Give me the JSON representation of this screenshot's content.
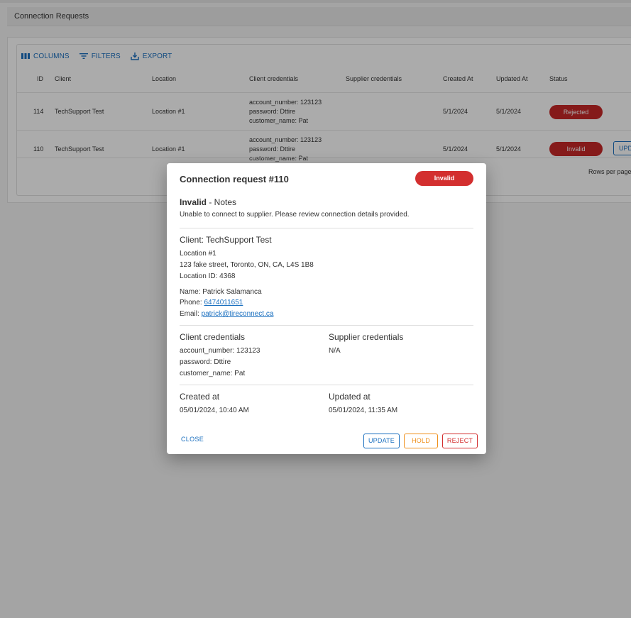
{
  "page": {
    "title": "Connection Requests"
  },
  "toolbar": {
    "columns": "COLUMNS",
    "filters": "FILTERS",
    "export": "EXPORT"
  },
  "table": {
    "headers": [
      "ID",
      "Client",
      "Location",
      "Client credentials",
      "Supplier credentials",
      "Created At",
      "Updated At",
      "Status"
    ],
    "rows": [
      {
        "id": "114",
        "client": "TechSupport Test",
        "location": "Location #1",
        "cred": [
          "account_number: 123123",
          "password: Dttire",
          "customer_name: Pat"
        ],
        "created": "5/1/2024",
        "updated": "5/1/2024",
        "status": "Rejected"
      },
      {
        "id": "110",
        "client": "TechSupport Test",
        "location": "Location #1",
        "cred": [
          "account_number: 123123",
          "password: Dttire",
          "customer_name: Pat"
        ],
        "created": "5/1/2024",
        "updated": "5/1/2024",
        "status": "Invalid",
        "action": "UPD"
      }
    ],
    "rows_per_page": "Rows per page"
  },
  "modal": {
    "title": "Connection request #110",
    "status": "Invalid",
    "notes_status": "Invalid",
    "notes_label": " - Notes",
    "notes_text": "Unable to connect to supplier. Please review connection details provided.",
    "client_heading": "Client: TechSupport Test",
    "location_name": "Location #1",
    "address": "123 fake street, Toronto, ON, CA, L4S 1B8",
    "location_id": "Location ID: 4368",
    "name": "Name: Patrick Salamanca",
    "phone_label": "Phone: ",
    "phone": "6474011651",
    "email_label": "Email: ",
    "email": "patrick@tireconnect.ca",
    "client_credentials_heading": "Client credentials",
    "client_credentials": [
      "account_number: 123123",
      "password: Dttire",
      "customer_name: Pat"
    ],
    "supplier_credentials_heading": "Supplier credentials",
    "supplier_credentials": "N/A",
    "created_heading": "Created at",
    "created_value": "05/01/2024, 10:40 AM",
    "updated_heading": "Updated at",
    "updated_value": "05/01/2024, 11:35 AM",
    "close_label": "CLOSE",
    "update_label": "UPDATE",
    "hold_label": "HOLD",
    "reject_label": "REJECT"
  },
  "colors": {
    "accent": "#1a6fbf",
    "danger": "#d32f2f",
    "warning": "#ef8f1a"
  },
  "icons": {
    "columns": "columns-icon",
    "filters": "filter-icon",
    "export": "export-icon"
  }
}
